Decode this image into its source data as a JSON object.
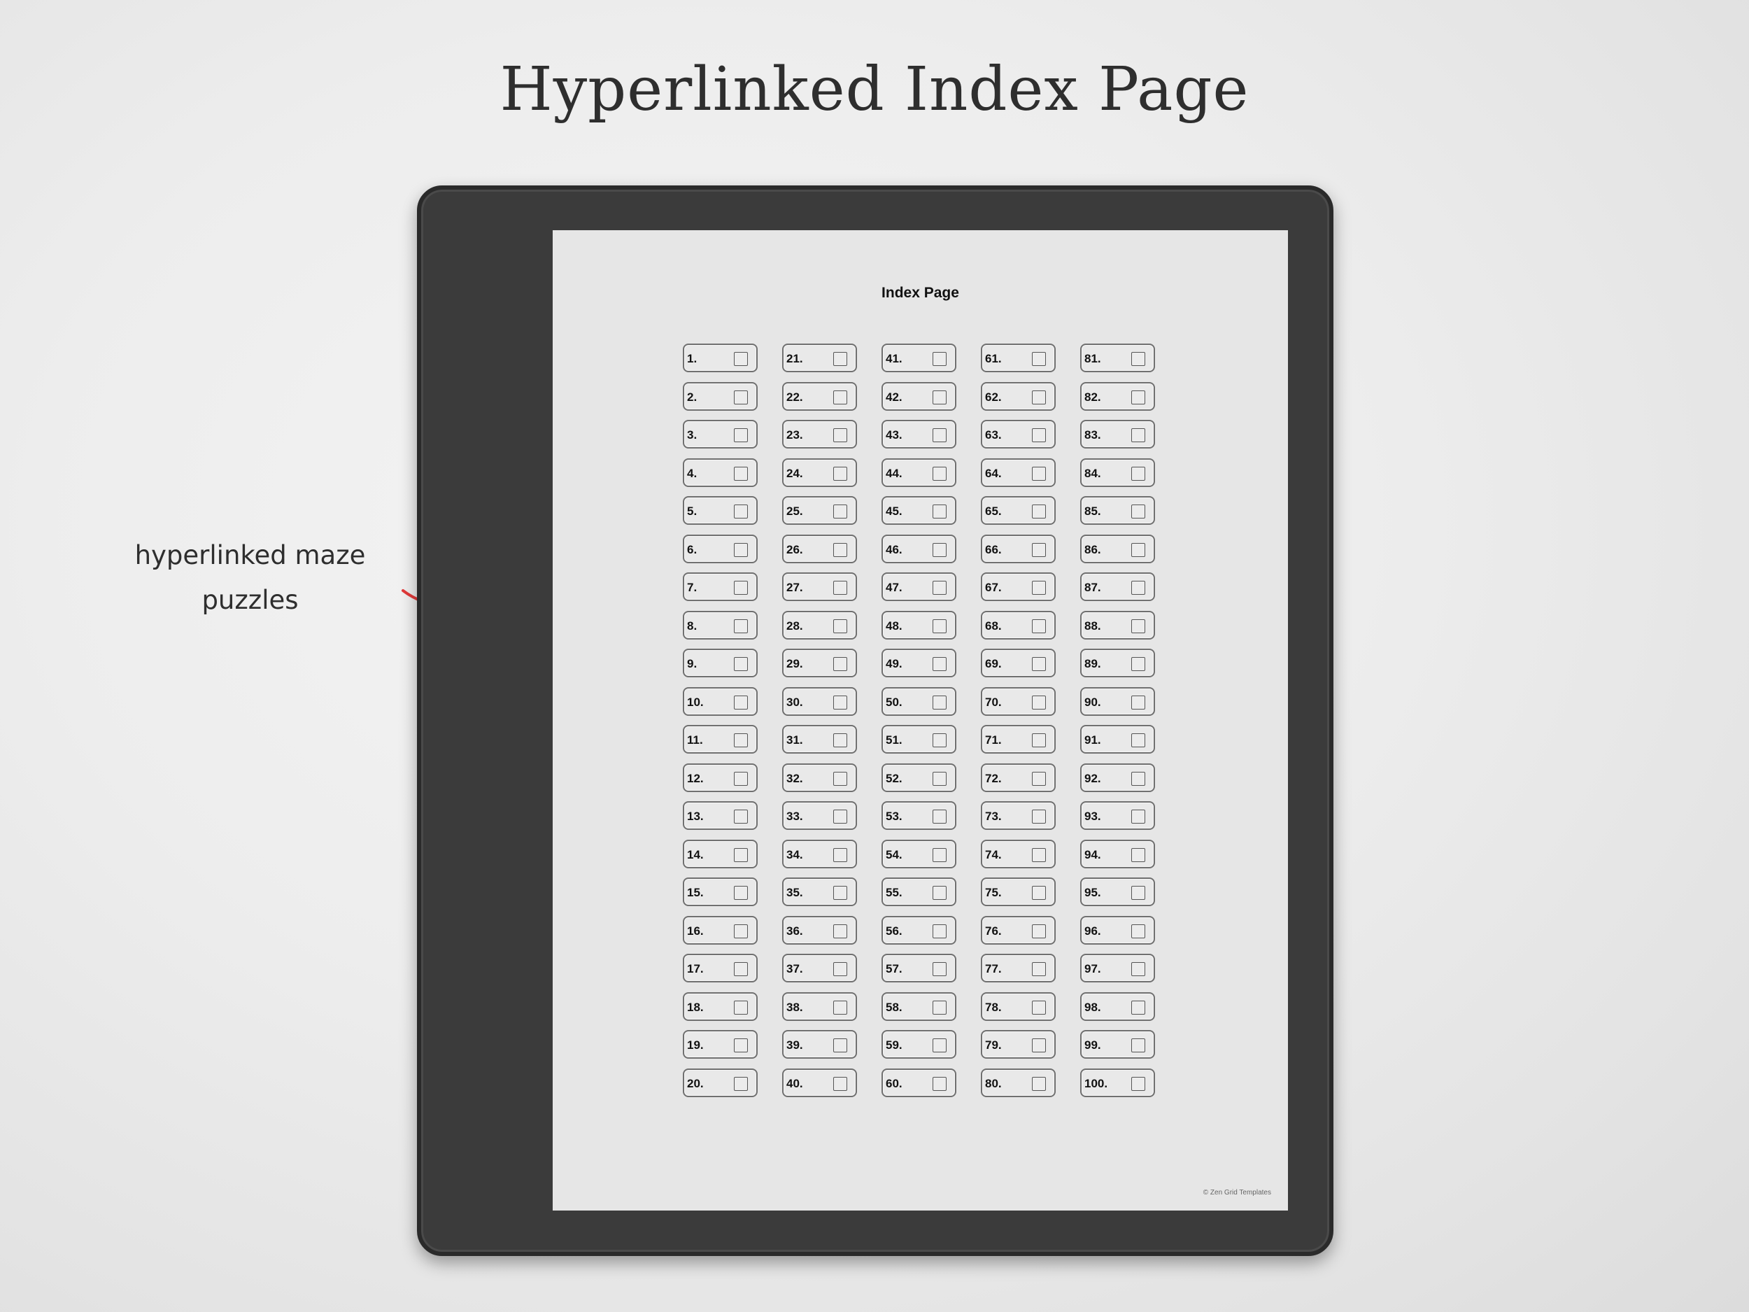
{
  "heading": "Hyperlinked Index Page",
  "annotation": {
    "line1": "hyperlinked maze",
    "line2": "puzzles",
    "arrow_color": "#e23a3a"
  },
  "screen": {
    "title": "Index Page",
    "footer": "© Zen Grid Templates",
    "entries": [
      "1.",
      "2.",
      "3.",
      "4.",
      "5.",
      "6.",
      "7.",
      "8.",
      "9.",
      "10.",
      "11.",
      "12.",
      "13.",
      "14.",
      "15.",
      "16.",
      "17.",
      "18.",
      "19.",
      "20.",
      "21.",
      "22.",
      "23.",
      "24.",
      "25.",
      "26.",
      "27.",
      "28.",
      "29.",
      "30.",
      "31.",
      "32.",
      "33.",
      "34.",
      "35.",
      "36.",
      "37.",
      "38.",
      "39.",
      "40.",
      "41.",
      "42.",
      "43.",
      "44.",
      "45.",
      "46.",
      "47.",
      "48.",
      "49.",
      "50.",
      "51.",
      "52.",
      "53.",
      "54.",
      "55.",
      "56.",
      "57.",
      "58.",
      "59.",
      "60.",
      "61.",
      "62.",
      "63.",
      "64.",
      "65.",
      "66.",
      "67.",
      "68.",
      "69.",
      "70.",
      "71.",
      "72.",
      "73.",
      "74.",
      "75.",
      "76.",
      "77.",
      "78.",
      "79.",
      "80.",
      "81.",
      "82.",
      "83.",
      "84.",
      "85.",
      "86.",
      "87.",
      "88.",
      "89.",
      "90.",
      "91.",
      "92.",
      "93.",
      "94.",
      "95.",
      "96.",
      "97.",
      "98.",
      "99.",
      "100."
    ]
  }
}
